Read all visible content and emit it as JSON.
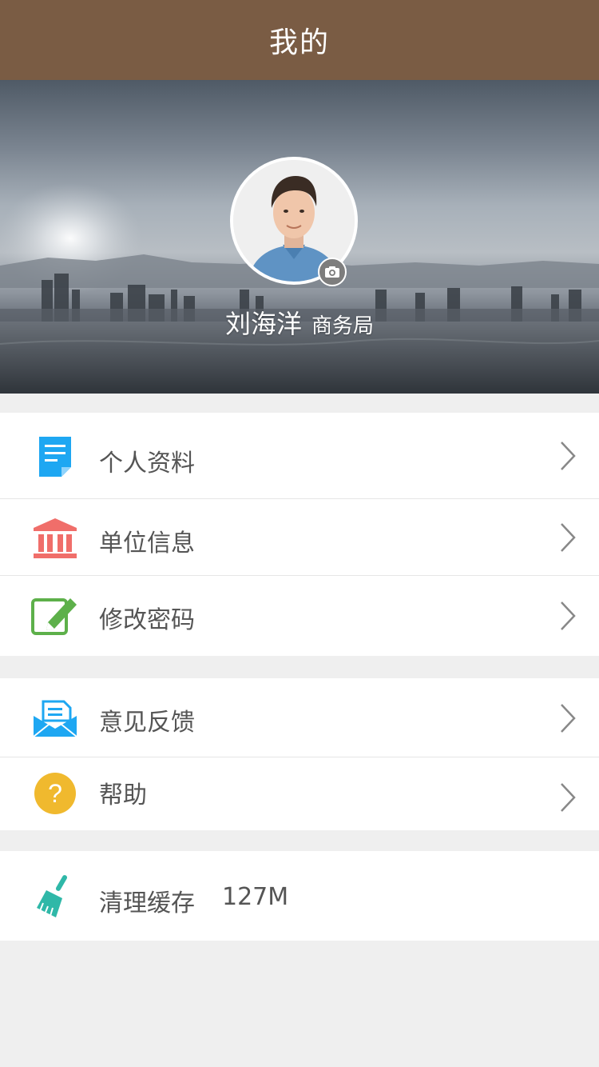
{
  "header": {
    "title": "我的"
  },
  "profile": {
    "name": "刘海洋",
    "department": "商务局"
  },
  "menu_groups": [
    {
      "items": [
        {
          "label": "个人资料",
          "icon": "document-icon",
          "color": "#1ea7f2"
        },
        {
          "label": "单位信息",
          "icon": "bank-icon",
          "color": "#f06e6a"
        },
        {
          "label": "修改密码",
          "icon": "edit-icon",
          "color": "#5db04a"
        }
      ]
    },
    {
      "items": [
        {
          "label": "意见反馈",
          "icon": "mail-icon",
          "color": "#1ea7f2"
        },
        {
          "label": "帮助",
          "icon": "question-icon",
          "color": "#f0b92e"
        }
      ]
    },
    {
      "items": [
        {
          "label": "清理缓存",
          "value": "127M",
          "icon": "broom-icon",
          "color": "#2fb8a8"
        }
      ]
    }
  ],
  "colors": {
    "header_bg": "#7a5c44",
    "page_bg": "#efefef",
    "text": "#555555"
  }
}
